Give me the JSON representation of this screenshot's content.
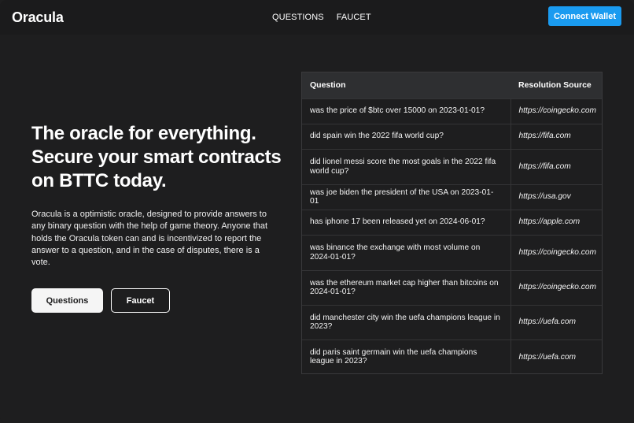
{
  "header": {
    "logo": "Oracula",
    "nav": [
      "QUESTIONS",
      "FAUCET"
    ],
    "connect_label": "Connect Wallet",
    "accent_color": "#1a9bf0"
  },
  "hero": {
    "title": "The oracle for everything. Secure your smart contracts on BTTC today.",
    "description": "Oracula is a optimistic oracle, designed to provide answers to any binary question with the help of game theory. Anyone that holds the Oracula token can and is incentivized to report the answer to a question, and in the case of disputes, there is a vote.",
    "primary_label": "Questions",
    "secondary_label": "Faucet"
  },
  "table": {
    "headers": [
      "Question",
      "Resolution Source"
    ],
    "rows": [
      {
        "question": "was the price of $btc over 15000 on 2023-01-01?",
        "source": "https://coingecko.com"
      },
      {
        "question": "did spain win the 2022 fifa world cup?",
        "source": "https://fifa.com"
      },
      {
        "question": "did lionel messi score the most goals in the 2022 fifa world cup?",
        "source": "https://fifa.com"
      },
      {
        "question": "was joe biden the president of the USA on 2023-01-01",
        "source": "https://usa.gov"
      },
      {
        "question": "has iphone 17 been released yet on 2024-06-01?",
        "source": "https://apple.com"
      },
      {
        "question": "was binance the exchange with most volume on 2024-01-01?",
        "source": "https://coingecko.com"
      },
      {
        "question": "was the ethereum market cap higher than bitcoins on 2024-01-01?",
        "source": "https://coingecko.com"
      },
      {
        "question": "did manchester city win the uefa champions league in 2023?",
        "source": "https://uefa.com"
      },
      {
        "question": "did paris saint germain win the uefa champions league in 2023?",
        "source": "https://uefa.com"
      }
    ]
  }
}
